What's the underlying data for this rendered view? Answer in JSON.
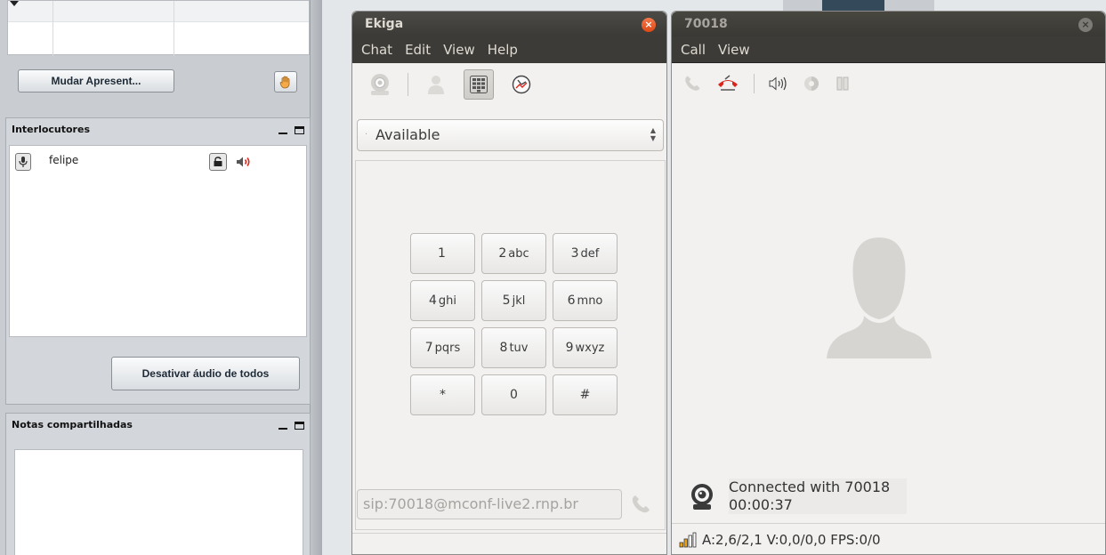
{
  "left_panel": {
    "presenter_button": "Mudar Apresent...",
    "participants": {
      "title": "Interlocutores",
      "items": [
        {
          "name": "felipe"
        }
      ],
      "mute_all_button": "Desativar áudio de todos"
    },
    "notes": {
      "title": "Notas compartilhadas"
    }
  },
  "ekiga": {
    "title": "Ekiga",
    "menu": [
      "Chat",
      "Edit",
      "View",
      "Help"
    ],
    "status": "Available",
    "keypad": [
      {
        "digit": "1",
        "letters": ""
      },
      {
        "digit": "2",
        "letters": "abc"
      },
      {
        "digit": "3",
        "letters": "def"
      },
      {
        "digit": "4",
        "letters": "ghi"
      },
      {
        "digit": "5",
        "letters": "jkl"
      },
      {
        "digit": "6",
        "letters": "mno"
      },
      {
        "digit": "7",
        "letters": "pqrs"
      },
      {
        "digit": "8",
        "letters": "tuv"
      },
      {
        "digit": "9",
        "letters": "wxyz"
      },
      {
        "digit": "*",
        "letters": ""
      },
      {
        "digit": "0",
        "letters": ""
      },
      {
        "digit": "#",
        "letters": ""
      }
    ],
    "uri": "sip:70018@mconf-live2.rnp.br"
  },
  "call": {
    "title": "70018",
    "menu": [
      "Call",
      "View"
    ],
    "status": "Connected with 70018",
    "timer": "00:00:37",
    "stats": "A:2,6/2,1 V:0,0/0,0 FPS:0/0"
  },
  "colors": {
    "accent_close": "#dd4814",
    "hangup_red": "#d9251d",
    "titlebar": "#3c3b37"
  }
}
